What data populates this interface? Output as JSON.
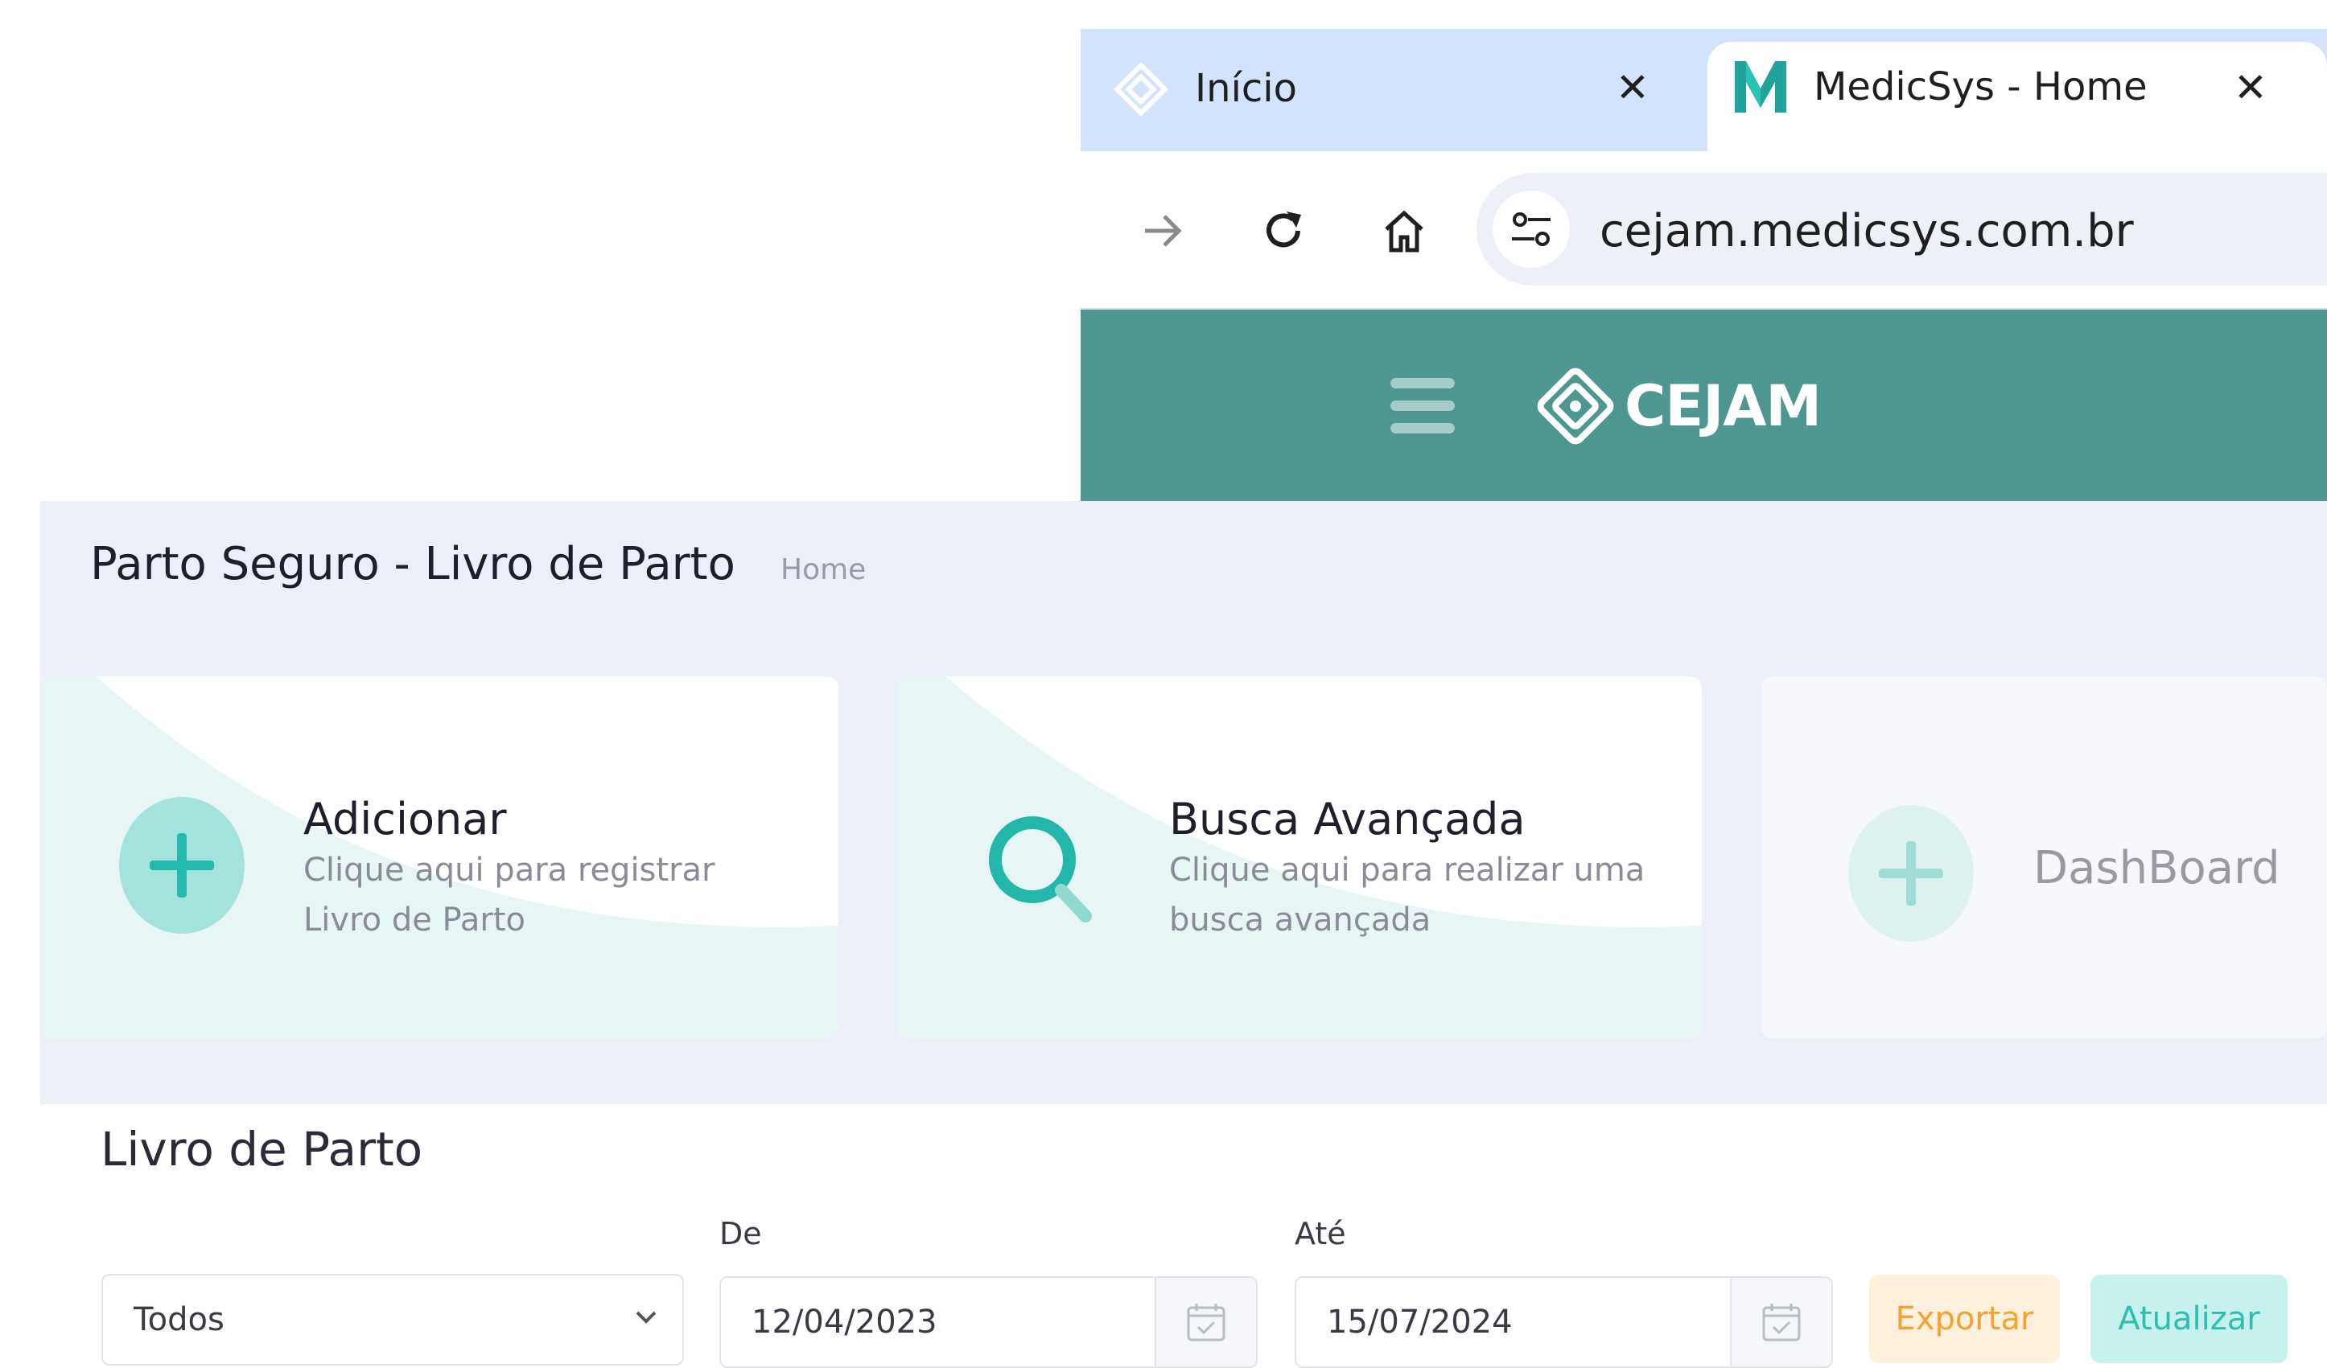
{
  "browser": {
    "tabs": [
      {
        "title": "Início",
        "icon": "cejam-logo-icon",
        "active": false
      },
      {
        "title": "MedicSys - Home",
        "icon": "medicsys-m-icon",
        "active": true
      }
    ],
    "address": "cejam.medicsys.com.br"
  },
  "header": {
    "brand": "CEJAM"
  },
  "page": {
    "title": "Parto Seguro - Livro de Parto",
    "breadcrumb": "Home"
  },
  "cards": {
    "add": {
      "title": "Adicionar",
      "desc": "Clique aqui para registrar Livro de Parto"
    },
    "search": {
      "title": "Busca Avançada",
      "desc": "Clique aqui para realizar uma busca avançada"
    },
    "dashboard": {
      "title": "DashBoard"
    }
  },
  "filters": {
    "section_title": "Livro de Parto",
    "select_value": "Todos",
    "from_label": "De",
    "from_value": "12/04/2023",
    "to_label": "Até",
    "to_value": "15/07/2024",
    "export_label": "Exportar",
    "refresh_label": "Atualizar"
  },
  "colors": {
    "header": "#4e9690",
    "accent": "#2ebfb0",
    "tabstrip": "#d3e3fd",
    "export": "#f4a232",
    "background": "#eceff8"
  }
}
